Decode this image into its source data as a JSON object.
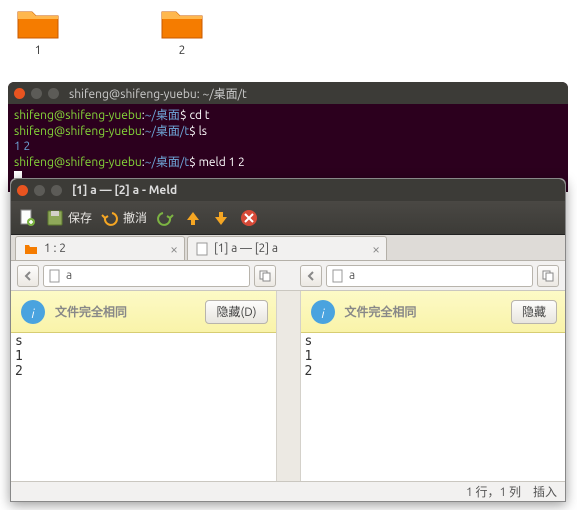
{
  "desktop": {
    "folders": [
      {
        "label": "1"
      },
      {
        "label": "2"
      }
    ]
  },
  "terminal": {
    "title": "shifeng@shifeng-yuebu: ~/桌面/t",
    "prompt_user": "shifeng@shifeng-yuebu",
    "prompt_path": "~/桌面/t",
    "cmd1": "cd t",
    "cmd2": "ls",
    "ls_output": "1  2",
    "cmd3": "meld 1 2"
  },
  "meld": {
    "title": "[1] a — [2] a - Meld",
    "toolbar": {
      "save": "保存",
      "undo": "撤消"
    },
    "tabs": [
      {
        "label": "1 : 2"
      },
      {
        "label": "[1] a — [2] a"
      }
    ],
    "path_left": "a",
    "path_right": "a",
    "info_left": {
      "text": "文件完全相同",
      "hide": "隐藏(D)"
    },
    "info_right": {
      "text": "文件完全相同",
      "hide": "隐藏"
    },
    "content_left": "s\n1\n2",
    "content_right": "s\n1\n2",
    "status": {
      "pos": "1 行，1 列",
      "mode": "插入"
    }
  }
}
